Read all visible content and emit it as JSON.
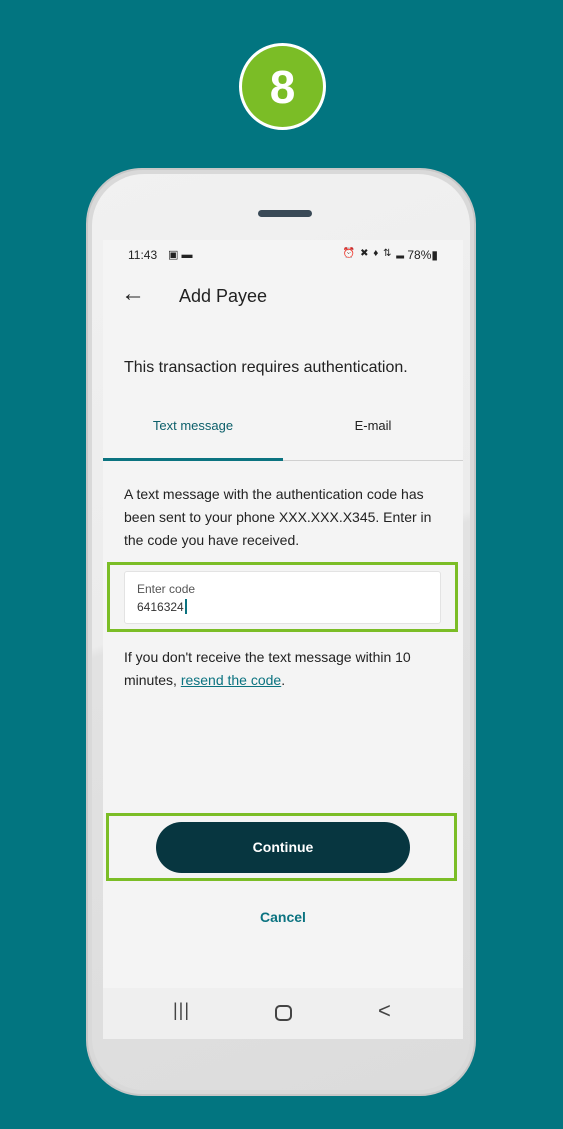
{
  "step_badge": {
    "number": "8",
    "color": "#7bbd26"
  },
  "status_bar": {
    "time": "11:43",
    "left_icons": [
      "image-icon",
      "message-icon"
    ],
    "left_glyphs": "▣ ▬",
    "right_icons": [
      "alarm-icon",
      "mute-icon",
      "location-icon",
      "lte-signal-icon",
      "signal-bars-icon"
    ],
    "right_glyphs": "⏰ ✖ ♦ ⇅ ▂",
    "battery": "78%▮"
  },
  "header": {
    "back_glyph": "←",
    "title": "Add Payee"
  },
  "auth_heading": "This transaction requires authentication.",
  "tabs": [
    {
      "label": "Text message",
      "active": true
    },
    {
      "label": "E-mail",
      "active": false
    }
  ],
  "body_text": "A text message with the authentication code has been sent to your phone XXX.XXX.X345. Enter in the code you have received.",
  "code_field": {
    "label": "Enter code",
    "value": "6416324"
  },
  "help": {
    "prefix": "If you don't receive the text message within 10 minutes, ",
    "link": "resend the code",
    "suffix": "."
  },
  "actions": {
    "continue_label": "Continue",
    "cancel_label": "Cancel"
  },
  "nav": {
    "recent_glyph": "|||",
    "back_glyph": "<"
  },
  "colors": {
    "background": "#027580",
    "accent": "#0b7380",
    "primary_button": "#073640",
    "highlight": "#7bbd26"
  }
}
